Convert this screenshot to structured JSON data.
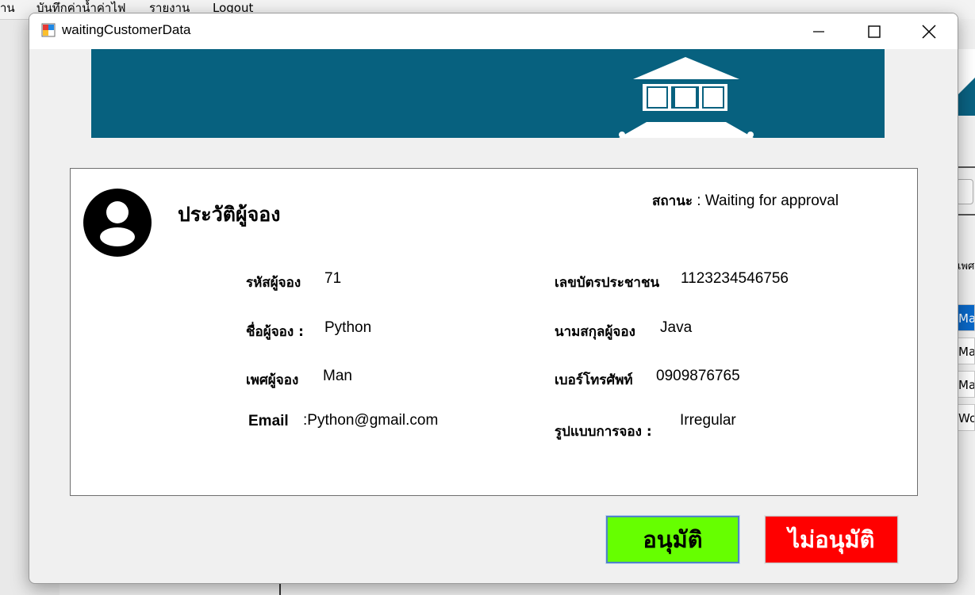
{
  "background": {
    "menu": [
      "าน",
      "บันทึกค่าน้ำค่าไฟ",
      "รายงาน",
      "Logout"
    ],
    "right_text": "เพศ",
    "right_cells": [
      "Man",
      "Man",
      "Man",
      "Wor"
    ]
  },
  "window": {
    "title": "waitingCustomerData",
    "minimize": "minimize",
    "maximize": "maximize",
    "close": "close"
  },
  "card": {
    "title": "ประวัติผู้จอง",
    "status_label": "สถานะ",
    "status_sep": " : ",
    "status_value": "Waiting for approval",
    "fields": {
      "booking_id_label": "รหัสผู้จอง",
      "booking_id_value": "71",
      "id_card_label": "เลขบัตรประชาชน",
      "id_card_value": "1123234546756",
      "first_name_label": "ชื่อผู้จอง :",
      "first_name_value": "Python",
      "last_name_label": "นามสกุลผู้จอง",
      "last_name_value": "Java",
      "gender_label": "เพศผู้จอง",
      "gender_value": "Man",
      "phone_label": "เบอร์โทรศัพท์",
      "phone_value": "0909876765",
      "email_label": "Email",
      "email_value": ":Python@gmail.com",
      "booking_type_label": "รูปแบบการจอง :",
      "booking_type_value": "Irregular"
    }
  },
  "buttons": {
    "approve": "อนุมัติ",
    "reject": "ไม่อนุมัติ"
  },
  "colors": {
    "banner": "#07617f",
    "approve": "#66ff00",
    "reject": "#ff0000"
  }
}
